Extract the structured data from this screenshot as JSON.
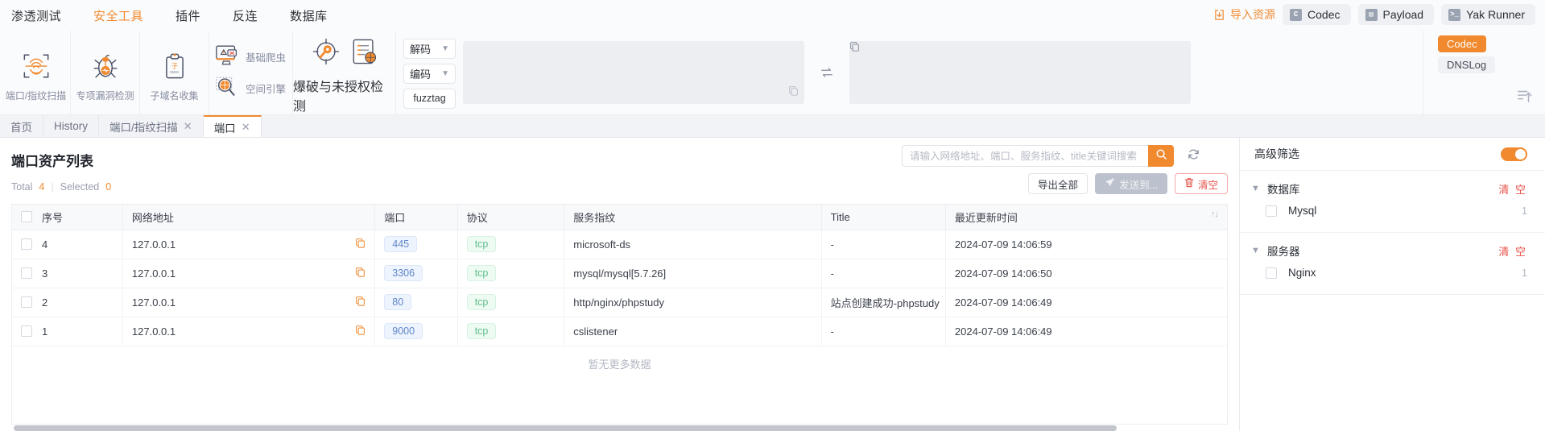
{
  "menubar": {
    "items": [
      {
        "label": "渗透测试",
        "active": false
      },
      {
        "label": "安全工具",
        "active": true
      },
      {
        "label": "插件",
        "active": false
      },
      {
        "label": "反连",
        "active": false
      },
      {
        "label": "数据库",
        "active": false
      }
    ],
    "import_label": "导入资源",
    "buttons": [
      {
        "label": "Codec",
        "icon": "codec-icon"
      },
      {
        "label": "Payload",
        "icon": "book-icon"
      },
      {
        "label": "Yak Runner",
        "icon": "terminal-icon"
      }
    ]
  },
  "ribbon": {
    "tools": [
      {
        "label": "端口/指纹扫描",
        "icon": "fingerprint-scan-icon"
      },
      {
        "label": "专项漏洞检测",
        "icon": "bug-icon"
      },
      {
        "label": "子域名收集",
        "icon": "clipboard-www-icon"
      }
    ],
    "stacked": [
      {
        "label": "基础爬虫",
        "icon": "crawler-monitor-icon"
      },
      {
        "label": "空间引擎",
        "icon": "magnifier-globe-icon"
      }
    ],
    "wide_tool": {
      "label": "爆破与未授权检测",
      "icons": [
        "key-target-icon",
        "list-target-icon"
      ]
    },
    "codec": {
      "decode_label": "解码",
      "encode_label": "编码",
      "fuzztag_label": "fuzztag",
      "input_value": "",
      "output_value": "",
      "swap_icon": "swap-arrows-icon",
      "copy_icon": "copy-icon"
    },
    "rail": {
      "codec_tag": "Codec",
      "dnslog_tag": "DNSLog",
      "expand_icon": "expand-up-icon"
    }
  },
  "tabs": [
    {
      "label": "首页",
      "closable": false,
      "active": false
    },
    {
      "label": "History",
      "closable": false,
      "active": false
    },
    {
      "label": "端口/指纹扫描",
      "closable": true,
      "active": false
    },
    {
      "label": "端口",
      "closable": true,
      "active": true
    }
  ],
  "page": {
    "title": "端口资产列表",
    "total_label": "Total",
    "total_value": "4",
    "selected_label": "Selected",
    "selected_value": "0",
    "no_more_data": "暂无更多数据"
  },
  "search": {
    "placeholder": "请输入网络地址、端口、服务指纹、title关键词搜索",
    "value": "",
    "search_icon": "search-icon",
    "refresh_icon": "refresh-icon"
  },
  "actions": {
    "export_label": "导出全部",
    "send_to_label": "发送到...",
    "clear_label": "清空",
    "send_icon": "send-icon",
    "trash_icon": "trash-icon"
  },
  "table": {
    "columns": [
      {
        "key": "idx",
        "label": "序号"
      },
      {
        "key": "addr",
        "label": "网络地址"
      },
      {
        "key": "port",
        "label": "端口"
      },
      {
        "key": "proto",
        "label": "协议"
      },
      {
        "key": "finger",
        "label": "服务指纹"
      },
      {
        "key": "title",
        "label": "Title"
      },
      {
        "key": "updated",
        "label": "最近更新时间",
        "sortable": true
      }
    ],
    "rows": [
      {
        "idx": "4",
        "addr": "127.0.0.1",
        "port": "445",
        "proto": "tcp",
        "finger": "microsoft-ds",
        "title": "-",
        "updated": "2024-07-09 14:06:59"
      },
      {
        "idx": "3",
        "addr": "127.0.0.1",
        "port": "3306",
        "proto": "tcp",
        "finger": "mysql/mysql[5.7.26]",
        "title": "-",
        "updated": "2024-07-09 14:06:50"
      },
      {
        "idx": "2",
        "addr": "127.0.0.1",
        "port": "80",
        "proto": "tcp",
        "finger": "http/nginx/phpstudy",
        "title": "站点创建成功-phpstudy",
        "updated": "2024-07-09 14:06:49"
      },
      {
        "idx": "1",
        "addr": "127.0.0.1",
        "port": "9000",
        "proto": "tcp",
        "finger": "cslistener",
        "title": "-",
        "updated": "2024-07-09 14:06:49"
      }
    ]
  },
  "filter_panel": {
    "title": "高级筛选",
    "enabled": true,
    "groups": [
      {
        "name": "数据库",
        "clear_label": "清 空",
        "items": [
          {
            "label": "Mysql",
            "count": "1"
          }
        ]
      },
      {
        "name": "服务器",
        "clear_label": "清 空",
        "items": [
          {
            "label": "Nginx",
            "count": "1"
          }
        ]
      }
    ]
  },
  "colors": {
    "accent": "#f1892e",
    "danger": "#e8524a",
    "port_tag": "#5f87c9",
    "proto_tag": "#5fbd8b"
  }
}
